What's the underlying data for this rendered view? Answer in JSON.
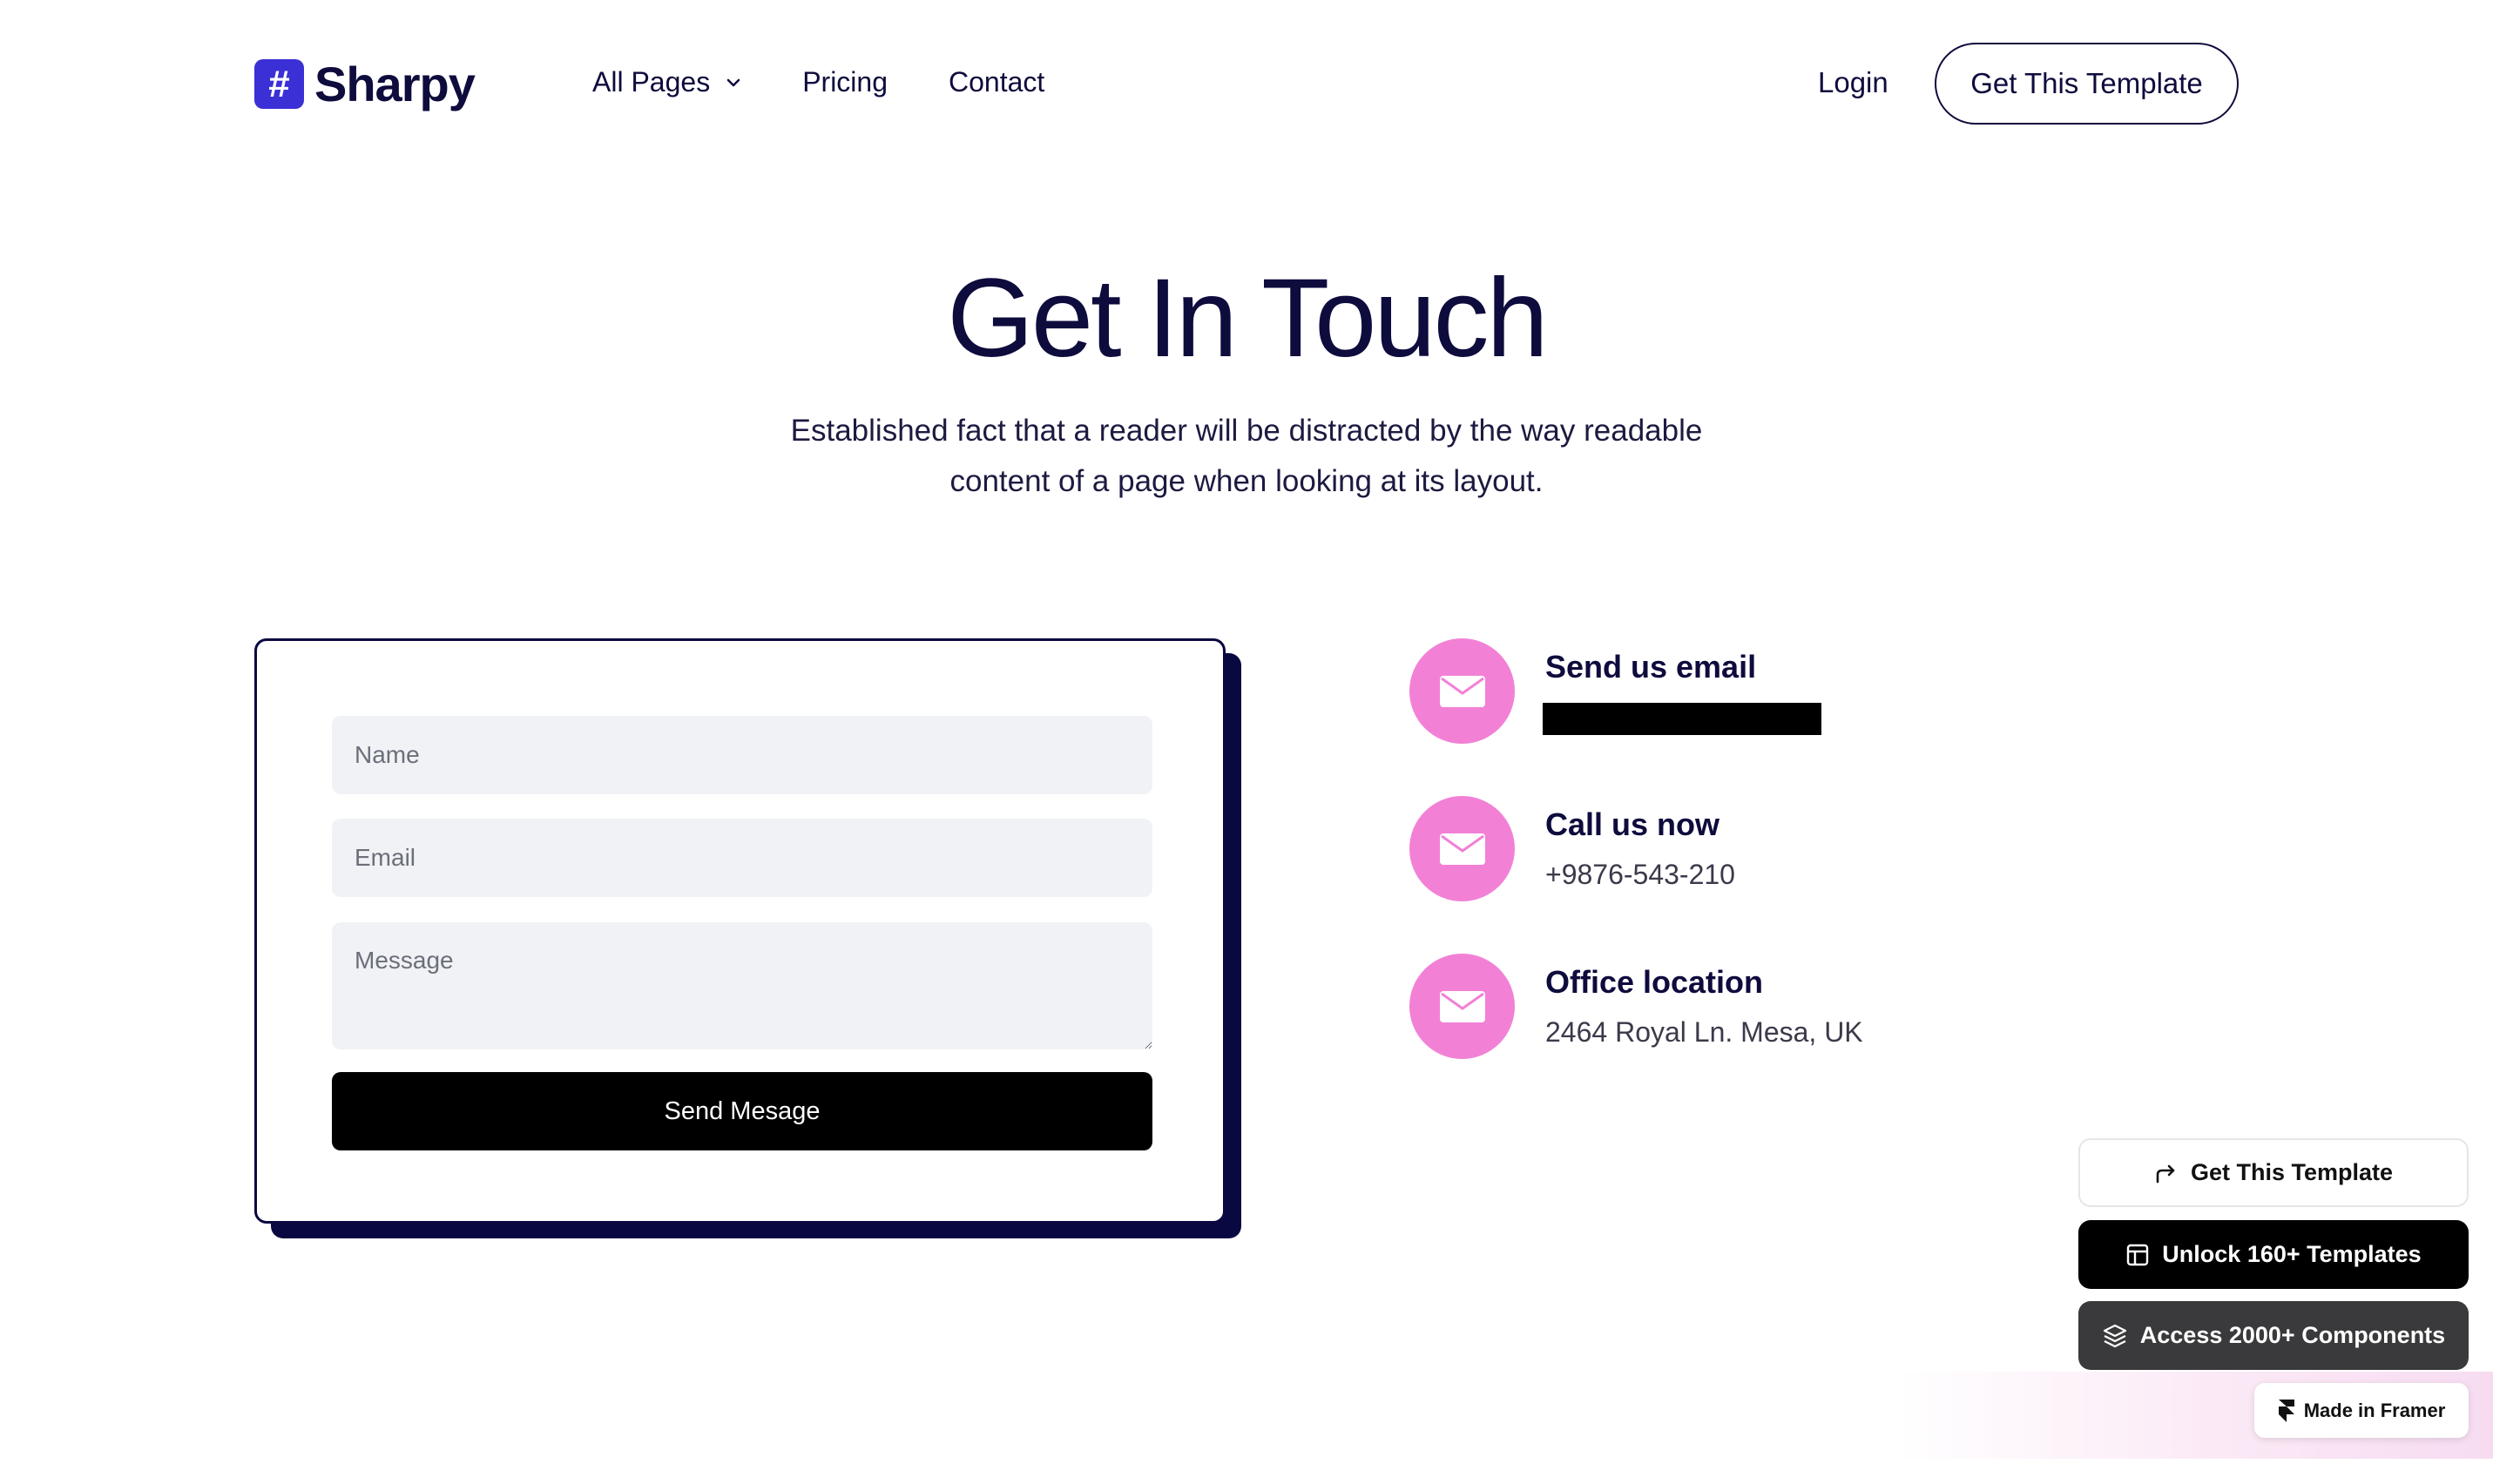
{
  "brand": {
    "logo_glyph": "#",
    "name": "Sharpy",
    "color": "#3b2fd6"
  },
  "nav": {
    "items": [
      {
        "label": "All Pages",
        "has_dropdown": true
      },
      {
        "label": "Pricing"
      },
      {
        "label": "Contact"
      }
    ],
    "login_label": "Login",
    "cta_label": "Get This Template"
  },
  "hero": {
    "title": "Get In Touch",
    "subtitle_line1": "Established fact that a reader will be distracted by the way readable",
    "subtitle_line2": "content of a page when looking at its layout."
  },
  "form": {
    "name_placeholder": "Name",
    "email_placeholder": "Email",
    "message_placeholder": "Message",
    "submit_label": "Send Mesage"
  },
  "contact": {
    "icon": "mail-icon",
    "icon_bg": "#f281d6",
    "items": [
      {
        "title": "Send us email",
        "value": "",
        "redacted": true
      },
      {
        "title": "Call us now",
        "value": "+9876-543-210"
      },
      {
        "title": "Office location",
        "value": "2464 Royal Ln. Mesa, UK"
      }
    ]
  },
  "framer": {
    "get_template": "Get This Template",
    "unlock": "Unlock 160+ Templates",
    "access": "Access 2000+ Components",
    "made_in": "Made in Framer"
  }
}
